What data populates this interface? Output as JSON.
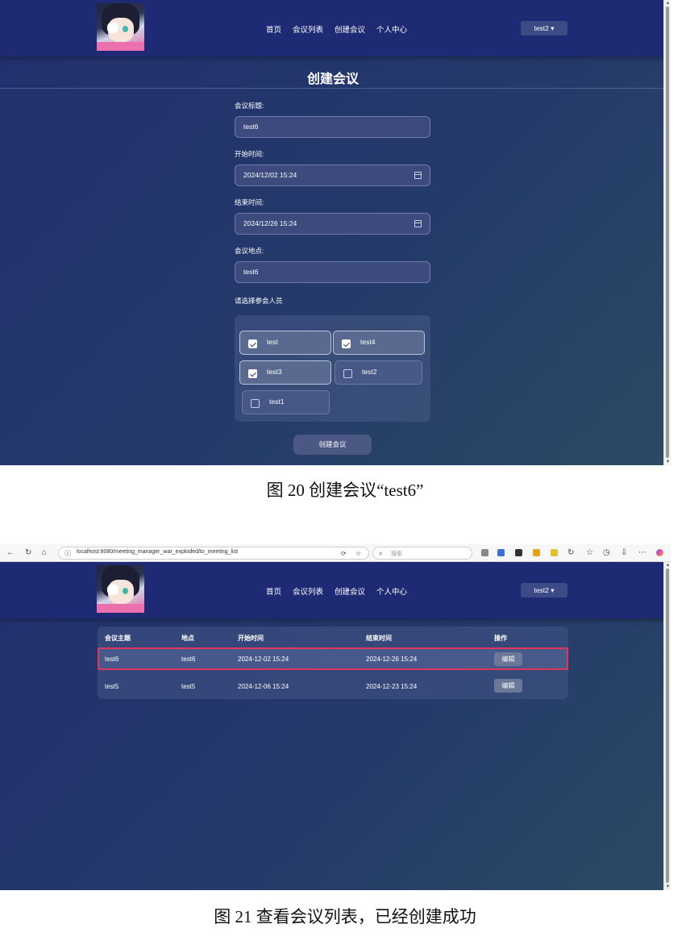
{
  "nav": {
    "links": [
      "首页",
      "会议列表",
      "创建会议",
      "个人中心"
    ],
    "user": "test2 ▾"
  },
  "create_form": {
    "title": "创建会议",
    "fields": [
      {
        "label": "会议标题:",
        "value": "test6"
      },
      {
        "label": "开始时间:",
        "value": "2024/12/02 15:24"
      },
      {
        "label": "结束时间:",
        "value": "2024/12/26 15:24"
      },
      {
        "label": "会议地点:",
        "value": "test6"
      }
    ],
    "attendees_label": "请选择参会人员",
    "attendees": [
      {
        "name": "test",
        "checked": true
      },
      {
        "name": "test4",
        "checked": true
      },
      {
        "name": "test3",
        "checked": true
      },
      {
        "name": "test2",
        "checked": false
      },
      {
        "name": "test1",
        "checked": false
      }
    ],
    "submit_label": "创建会议"
  },
  "caption_20": "图 20 创建会议“test6”",
  "browser": {
    "url": "localhost:8080/meeting_manager_war_exploded/to_meeting_list",
    "search_placeholder": "搜索"
  },
  "meeting_list": {
    "headers": [
      "会议主题",
      "地点",
      "开始时间",
      "结束时间",
      "操作"
    ],
    "rows": [
      {
        "topic": "test6",
        "place": "test6",
        "start": "2024-12-02 15:24",
        "end": "2024-12-26 15:24",
        "action": "编辑"
      },
      {
        "topic": "test5",
        "place": "test5",
        "start": "2024-12-06 15:24",
        "end": "2024-12-23 15:24",
        "action": "编辑"
      }
    ]
  },
  "caption_21": "图 21  查看会议列表，已经创建成功",
  "colors": {
    "navbar": "#1e2a74",
    "highlight": "#e0345c"
  }
}
